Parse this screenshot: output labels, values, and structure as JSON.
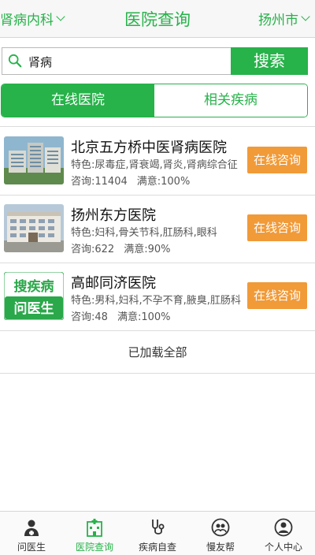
{
  "header": {
    "department": "肾病内科",
    "title": "医院查询",
    "city": "扬州市"
  },
  "search": {
    "query": "肾病",
    "button": "搜索"
  },
  "tabs": [
    {
      "label": "在线医院",
      "active": true
    },
    {
      "label": "相关疾病",
      "active": false
    }
  ],
  "hospitals": [
    {
      "name": "北京五方桥中医肾病医院",
      "specialty": "特色:尿毒症,肾衰竭,肾炎,肾病综合征",
      "consults": "咨询:11404",
      "satisfaction": "满意:100%",
      "button": "在线咨询"
    },
    {
      "name": "扬州东方医院",
      "specialty": "特色:妇科,骨关节科,肛肠科,眼科",
      "consults": "咨询:622",
      "satisfaction": "满意:90%",
      "button": "在线咨询"
    },
    {
      "name": "高邮同济医院",
      "specialty": "特色:男科,妇科,不孕不育,腋臭,肛肠科",
      "consults": "咨询:48",
      "satisfaction": "满意:100%",
      "button": "在线咨询",
      "logo_text": [
        "搜疾病",
        "问医生"
      ]
    }
  ],
  "loaded_all": "已加载全部",
  "nav": [
    {
      "label": "问医生",
      "icon": "doctor-icon",
      "active": false
    },
    {
      "label": "医院查询",
      "icon": "hospital-icon",
      "active": true
    },
    {
      "label": "疾病自查",
      "icon": "stethoscope-icon",
      "active": false
    },
    {
      "label": "慢友帮",
      "icon": "friends-icon",
      "active": false
    },
    {
      "label": "个人中心",
      "icon": "user-icon",
      "active": false
    }
  ],
  "colors": {
    "primary": "#27b24a",
    "accent": "#f19a38"
  }
}
